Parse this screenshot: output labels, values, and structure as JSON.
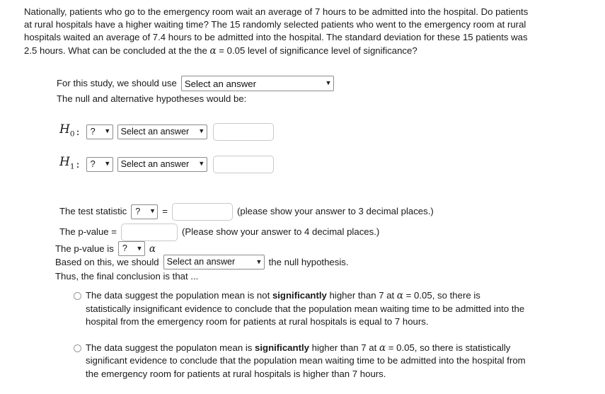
{
  "problem": {
    "paragraph": "Nationally, patients who go to the emergency room wait an average of 7 hours to be admitted into the hospital. Do patients at rural hospitals have a higher waiting time? The 15 randomly selected patients who went to the emergency room at rural hospitals waited an average of 7.4 hours to be admitted into the hospital. The standard deviation for these 15 patients was 2.5 hours. What can be concluded at the the ",
    "paragraph_tail": " = 0.05 level of significance level of significance?",
    "alpha_symbol": "α"
  },
  "study": {
    "prompt": "For this study, we should use",
    "select_value": "Select an answer",
    "hypotheses_prompt": "The null and alternative hypotheses would be:"
  },
  "hypotheses": [
    {
      "label": "H",
      "subscript": "0",
      "colon": ":",
      "param_select": "?",
      "relation_select": "Select an answer",
      "value": ""
    },
    {
      "label": "H",
      "subscript": "1",
      "colon": ":",
      "param_select": "?",
      "relation_select": "Select an answer",
      "value": ""
    }
  ],
  "statistic": {
    "label": "The test statistic",
    "type_select": "?",
    "equals": "=",
    "value": "",
    "hint": "(please show your answer to 3 decimal places.)"
  },
  "pvalue": {
    "label": "The p-value =",
    "value": "",
    "hint": "(Please show your answer to 4 decimal places.)",
    "compare_label": "The p-value is",
    "compare_select": "?",
    "compare_alpha": "α"
  },
  "decision": {
    "prefix": "Based on this, we should",
    "select_value": "Select an answer",
    "suffix": "the null hypothesis.",
    "conclusion_prompt": "Thus, the final conclusion is that ..."
  },
  "conclusion_options": [
    {
      "pre": "The data suggest the population mean is not ",
      "bold": "significantly",
      "post_a": " higher than 7 at ",
      "alpha": "α",
      "post_b": " = 0.05, so there is statistically insignificant evidence to conclude that the population mean waiting time to be admitted into the hospital from the emergency room for patients at rural hospitals is equal to 7 hours.",
      "selected": false
    },
    {
      "pre": "The data suggest the populaton mean is ",
      "bold": "significantly",
      "post_a": " higher than 7 at ",
      "alpha": "α",
      "post_b": " = 0.05, so there is statistically significant evidence to conclude that the population mean waiting time to be admitted into the hospital from the emergency room for patients at rural hospitals is higher than 7 hours.",
      "selected": false
    }
  ]
}
